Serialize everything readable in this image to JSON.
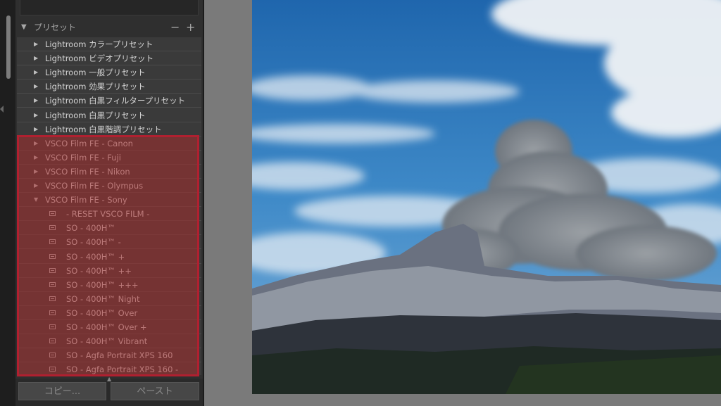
{
  "panel": {
    "section_title": "プリセット",
    "minus_label": "−",
    "plus_label": "+",
    "rows": [
      {
        "kind": "folder",
        "arrow": "▶",
        "label": "Lightroom カラープリセット"
      },
      {
        "kind": "folder",
        "arrow": "▶",
        "label": "Lightroom ビデオプリセット"
      },
      {
        "kind": "folder",
        "arrow": "▶",
        "label": "Lightroom 一般プリセット"
      },
      {
        "kind": "folder",
        "arrow": "▶",
        "label": "Lightroom 効果プリセット"
      },
      {
        "kind": "folder",
        "arrow": "▶",
        "label": "Lightroom 白黒フィルタープリセット"
      },
      {
        "kind": "folder",
        "arrow": "▶",
        "label": "Lightroom 白黒プリセット"
      },
      {
        "kind": "folder",
        "arrow": "▶",
        "label": "Lightroom 白黒階調プリセット"
      },
      {
        "kind": "folder",
        "arrow": "▶",
        "label": "VSCO Film FE - Canon"
      },
      {
        "kind": "folder",
        "arrow": "▶",
        "label": "VSCO Film FE - Fuji"
      },
      {
        "kind": "folder",
        "arrow": "▶",
        "label": "VSCO Film FE - Nikon"
      },
      {
        "kind": "folder",
        "arrow": "▶",
        "label": "VSCO Film FE - Olympus"
      },
      {
        "kind": "folder",
        "arrow": "▼",
        "label": "VSCO Film FE - Sony"
      },
      {
        "kind": "preset",
        "label": "- RESET VSCO FILM -"
      },
      {
        "kind": "preset",
        "label": "SO - 400H™"
      },
      {
        "kind": "preset",
        "label": "SO - 400H™ -"
      },
      {
        "kind": "preset",
        "label": "SO - 400H™ +"
      },
      {
        "kind": "preset",
        "label": "SO - 400H™ ++"
      },
      {
        "kind": "preset",
        "label": "SO - 400H™ +++"
      },
      {
        "kind": "preset",
        "label": "SO - 400H™ Night"
      },
      {
        "kind": "preset",
        "label": "SO - 400H™ Over"
      },
      {
        "kind": "preset",
        "label": "SO - 400H™ Over +"
      },
      {
        "kind": "preset",
        "label": "SO - 400H™ Vibrant"
      },
      {
        "kind": "preset",
        "label": "SO - Agfa Portrait XPS 160"
      },
      {
        "kind": "preset",
        "label": "SO - Agfa Portrait XPS 160 -"
      }
    ]
  },
  "bottom": {
    "copy_label": "コピー...",
    "paste_label": "ペースト"
  },
  "colors": {
    "highlight_border": "#b02030",
    "highlight_fill": "#a52d2d"
  },
  "icons": {
    "section_toggle": "collapse-triangle-icon",
    "preset": "preset-icon",
    "folder": "folder-disclosure-icon"
  }
}
